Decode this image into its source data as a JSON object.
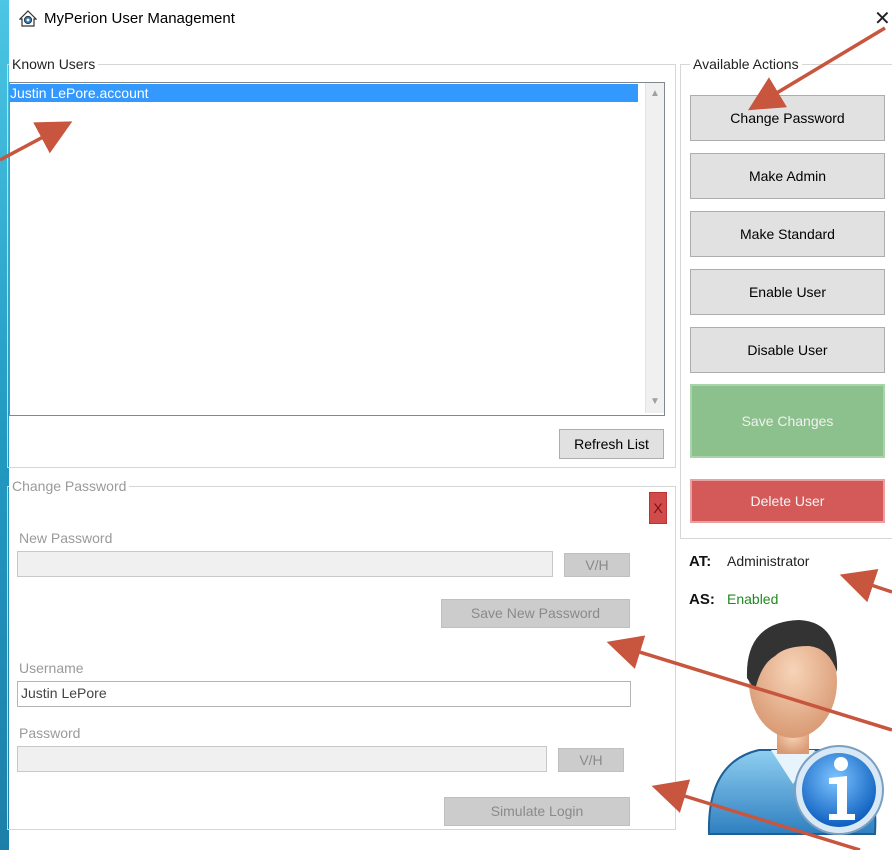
{
  "window": {
    "title": "MyPerion User Management",
    "close_label": "✕"
  },
  "known_users": {
    "legend": "Known Users",
    "items": [
      "Justin LePore.account"
    ],
    "refresh_label": "Refresh List"
  },
  "actions": {
    "legend": "Available Actions",
    "change_password": "Change Password",
    "make_admin": "Make Admin",
    "make_standard": "Make Standard",
    "enable_user": "Enable User",
    "disable_user": "Disable User",
    "save_changes": "Save Changes",
    "delete_user": "Delete User"
  },
  "status": {
    "at_key": "AT:",
    "at_value": "Administrator",
    "as_key": "AS:",
    "as_value": "Enabled",
    "as_color": "#1f8a1f"
  },
  "change_password": {
    "legend": "Change Password",
    "close_label": "X",
    "new_password_label": "New Password",
    "new_password_value": "",
    "vh_label": "V/H",
    "save_label": "Save New Password",
    "username_label": "Username",
    "username_value": "Justin LePore",
    "password_label": "Password",
    "password_value": "",
    "vh2_label": "V/H",
    "simulate_label": "Simulate Login"
  },
  "colors": {
    "selection": "#3399ff",
    "save_green": "#8cc08c",
    "delete_red": "#d45a5a",
    "arrow": "#c8553d"
  }
}
